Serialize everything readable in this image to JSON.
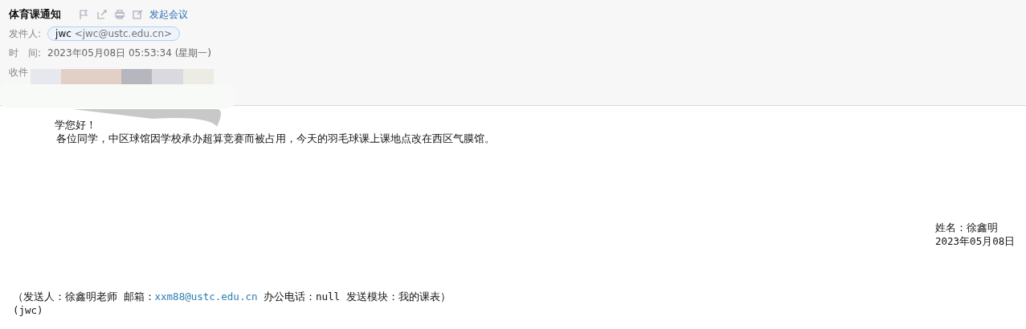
{
  "header": {
    "subject": "体育课通知",
    "meeting_link": "发起会议",
    "sender": {
      "label": "发件人:",
      "name": "jwc",
      "address": "<jwc@ustc.edu.cn>"
    },
    "time": {
      "label": "时　间:",
      "value": "2023年05月08日 05:53:34 (星期一)"
    },
    "recipients": {
      "label": "收件"
    }
  },
  "body": {
    "greeting": "学您好！",
    "paragraph": "各位同学，中区球馆因学校承办超算竞赛而被占用，今天的羽毛球课上课地点改在西区气膜馆。",
    "signature": [
      "姓名：徐鑫明",
      "2023年05月08日"
    ],
    "footer": {
      "before": "（发送人：徐鑫明老师 邮箱：",
      "email": "xxm88@ustc.edu.cn",
      "after": " 办公电话：null 发送模块：我的课表）"
    },
    "footer_sign": "(jwc)"
  }
}
